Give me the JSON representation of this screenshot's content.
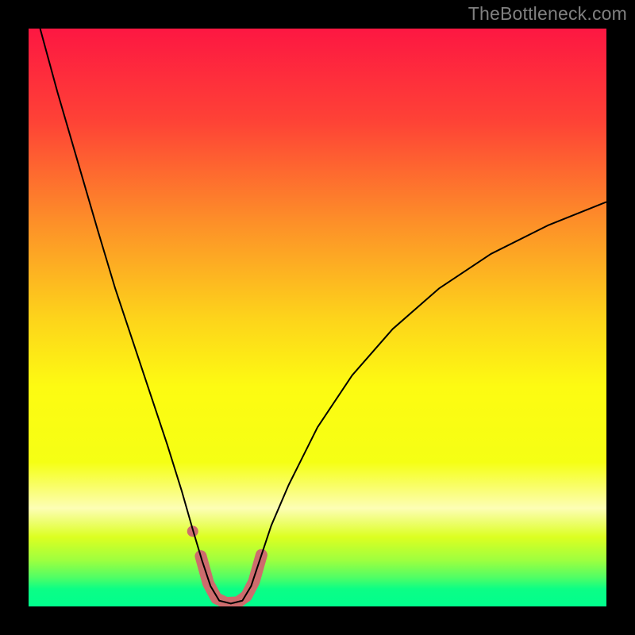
{
  "watermark": "TheBottleneck.com",
  "chart_data": {
    "type": "line",
    "title": "",
    "xlabel": "",
    "ylabel": "",
    "xlim": [
      0,
      100
    ],
    "ylim": [
      0,
      100
    ],
    "background_gradient": {
      "stops": [
        {
          "pos": 0.0,
          "color": "#fd1742"
        },
        {
          "pos": 0.16,
          "color": "#fe4236"
        },
        {
          "pos": 0.33,
          "color": "#fd8d29"
        },
        {
          "pos": 0.5,
          "color": "#fdd31b"
        },
        {
          "pos": 0.62,
          "color": "#fdfb12"
        },
        {
          "pos": 0.75,
          "color": "#f5ff14"
        },
        {
          "pos": 0.83,
          "color": "#fdfeb5"
        },
        {
          "pos": 0.88,
          "color": "#dcff21"
        },
        {
          "pos": 0.92,
          "color": "#9eff3f"
        },
        {
          "pos": 0.95,
          "color": "#50fe65"
        },
        {
          "pos": 0.97,
          "color": "#0bfe86"
        },
        {
          "pos": 1.0,
          "color": "#01ff8d"
        }
      ]
    },
    "series": [
      {
        "name": "bottleneck-curve",
        "color": "#000000",
        "stroke_width": 2,
        "points": [
          {
            "x": 2.0,
            "y": 100.0
          },
          {
            "x": 5.0,
            "y": 89.0
          },
          {
            "x": 8.5,
            "y": 77.0
          },
          {
            "x": 12.0,
            "y": 65.0
          },
          {
            "x": 15.0,
            "y": 55.0
          },
          {
            "x": 18.0,
            "y": 46.0
          },
          {
            "x": 21.0,
            "y": 37.0
          },
          {
            "x": 24.0,
            "y": 28.0
          },
          {
            "x": 26.5,
            "y": 20.0
          },
          {
            "x": 28.5,
            "y": 13.0
          },
          {
            "x": 30.0,
            "y": 8.0
          },
          {
            "x": 31.5,
            "y": 3.5
          },
          {
            "x": 33.0,
            "y": 1.0
          },
          {
            "x": 35.0,
            "y": 0.5
          },
          {
            "x": 37.0,
            "y": 1.0
          },
          {
            "x": 38.5,
            "y": 3.5
          },
          {
            "x": 40.0,
            "y": 8.0
          },
          {
            "x": 42.0,
            "y": 14.0
          },
          {
            "x": 45.0,
            "y": 21.0
          },
          {
            "x": 50.0,
            "y": 31.0
          },
          {
            "x": 56.0,
            "y": 40.0
          },
          {
            "x": 63.0,
            "y": 48.0
          },
          {
            "x": 71.0,
            "y": 55.0
          },
          {
            "x": 80.0,
            "y": 61.0
          },
          {
            "x": 90.0,
            "y": 66.0
          },
          {
            "x": 100.0,
            "y": 70.0
          }
        ]
      },
      {
        "name": "highlight-band",
        "color": "#cd6c6d",
        "stroke_width": 15,
        "linecap": "round",
        "points": [
          {
            "x": 29.8,
            "y": 8.7
          },
          {
            "x": 31.1,
            "y": 4.0
          },
          {
            "x": 32.5,
            "y": 1.4
          },
          {
            "x": 34.2,
            "y": 0.6
          },
          {
            "x": 36.2,
            "y": 0.7
          },
          {
            "x": 37.7,
            "y": 1.8
          },
          {
            "x": 39.0,
            "y": 4.3
          },
          {
            "x": 40.3,
            "y": 8.9
          }
        ]
      },
      {
        "name": "highlight-dot",
        "color": "#cd6c6d",
        "type": "scatter",
        "radius": 7,
        "points": [
          {
            "x": 28.4,
            "y": 13.0
          }
        ]
      }
    ]
  }
}
